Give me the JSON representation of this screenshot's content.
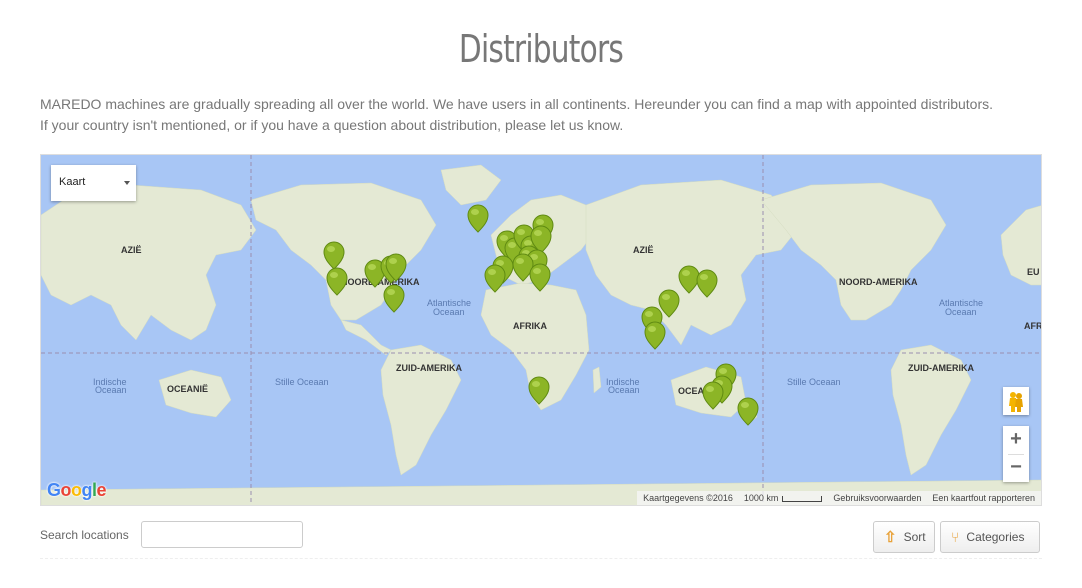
{
  "page": {
    "title": "Distributors",
    "intro_line1": "MAREDO machines are gradually spreading all over the world. We have users in all continents. Hereunder you can find a map with appointed distributors.",
    "intro_line2": "If your country isn't mentioned, or if you have a question about distribution, please let us know."
  },
  "map": {
    "type_selector": "Kaart",
    "labels": {
      "azie": "AZIË",
      "noord_amerika": "NOORD-AMERIKA",
      "zuid_amerika": "ZUID-AMERIKA",
      "afrika": "AFRIKA",
      "oceanie": "OCEANIË",
      "eu": "EU",
      "atl_1": "Atlantische",
      "atl_2": "Oceaan",
      "ind_1": "Indische",
      "ind_2": "Oceaan",
      "stille": "Stille Oceaan"
    },
    "zoom_in": "+",
    "zoom_out": "−",
    "logo": "Google",
    "attribution": "Kaartgegevens ©2016",
    "scale": "1000 km",
    "terms": "Gebruiksvoorwaarden",
    "report": "Een kaartfout rapporteren",
    "colors": {
      "water": "#a8c6f5",
      "land": "#e4e9d4",
      "marker": "#8cb526"
    },
    "icons": {
      "pegman": "pegman-icon",
      "dropdown": "chevron-down-icon"
    }
  },
  "search": {
    "label": "Search locations",
    "value": "",
    "placeholder": ""
  },
  "buttons": {
    "sort": "Sort",
    "categories": "Categories"
  }
}
